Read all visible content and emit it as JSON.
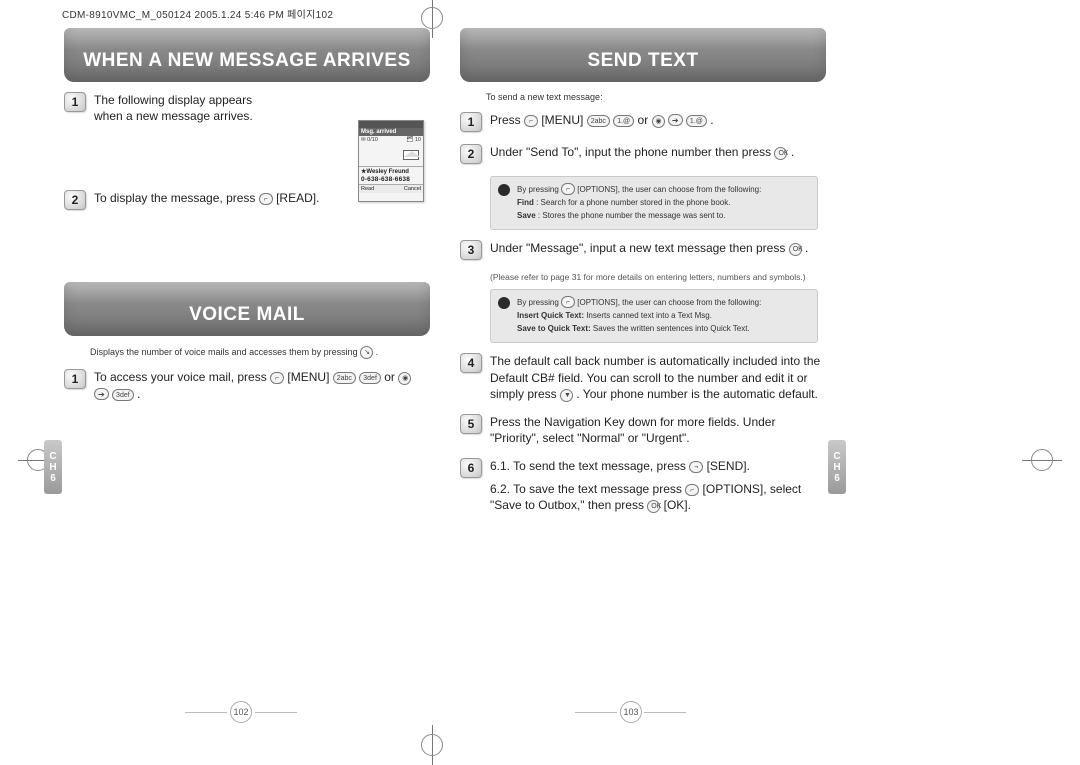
{
  "header_line": "CDM-8910VMC_M_050124  2005.1.24 5:46 PM  페이지102",
  "chapter_tab": {
    "line1": "C",
    "line2": "H",
    "line3": "6"
  },
  "left_page": {
    "title_1": "WHEN A NEW MESSAGE ARRIVES",
    "step1": "The following display appears when a new message arrives.",
    "phone": {
      "msg_arrived": "Msg. arrived",
      "icon_sms": "0/10",
      "icon_txt": "10",
      "contact": "Wesley Freund",
      "number": "0-638-638-6638",
      "soft_left": "Read",
      "soft_right": "Cancel"
    },
    "step2_a": "To display the message, press ",
    "step2_b": " [READ].",
    "title_2": "VOICE MAIL",
    "vm_intro": "Displays the number of voice mails and accesses them by pressing ",
    "vm_step1_a": "To access your voice mail, press ",
    "vm_step1_b": " [MENU] ",
    "vm_step1_c": " or ",
    "page_number": "102"
  },
  "right_page": {
    "title": "SEND TEXT",
    "intro": "To send a new text message:",
    "s1_a": "Press ",
    "s1_b": " [MENU] ",
    "s1_c": " or ",
    "s1_d": " .",
    "s2_a": "Under \"Send To\", input the phone number then press ",
    "s2_b": " .",
    "tip1_intro_a": "By pressing ",
    "tip1_intro_b": " [OPTIONS], the user can choose from the following:",
    "tip1_find_label": "Find",
    "tip1_find": " : Search for a phone number stored in the phone book.",
    "tip1_save_label": "Save",
    "tip1_save": " : Stores the phone number the message was sent to.",
    "s3_a": "Under \"Message\", input a new text message then press ",
    "s3_b": " .",
    "s3_note": "(Please refer to page 31 for more details on entering letters, numbers and symbols.)",
    "tip2_intro_a": "By pressing ",
    "tip2_intro_b": " [OPTIONS], the user can choose from the following:",
    "tip2_iqt_label": "Insert Quick Text:",
    "tip2_iqt": " Inserts canned text into a Text Msg.",
    "tip2_sqt_label": "Save to Quick Text:",
    "tip2_sqt": " Saves the written sentences into Quick Text.",
    "s4_a": "The default call back number is automatically included into the Default CB# field. You can scroll to the number and edit it or simply press ",
    "s4_b": " . Your phone number is the automatic default.",
    "s5": "Press the Navigation Key down for more fields. Under \"Priority\", select \"Normal\" or \"Urgent\".",
    "s6_1a": "6.1. To send the text message, press ",
    "s6_1b": " [SEND].",
    "s6_2a": "6.2. To save the text message press ",
    "s6_2b": " [OPTIONS], select \"Save to Outbox,\" then press ",
    "s6_2c": " [OK].",
    "page_number": "103"
  },
  "key_labels": {
    "softleft": "⌐",
    "softright": "¬",
    "ok": "OK",
    "nav": "◉",
    "k2": "2abc",
    "k3": "3def",
    "k1": "1.@",
    "send": "↘",
    "down": "▼"
  }
}
